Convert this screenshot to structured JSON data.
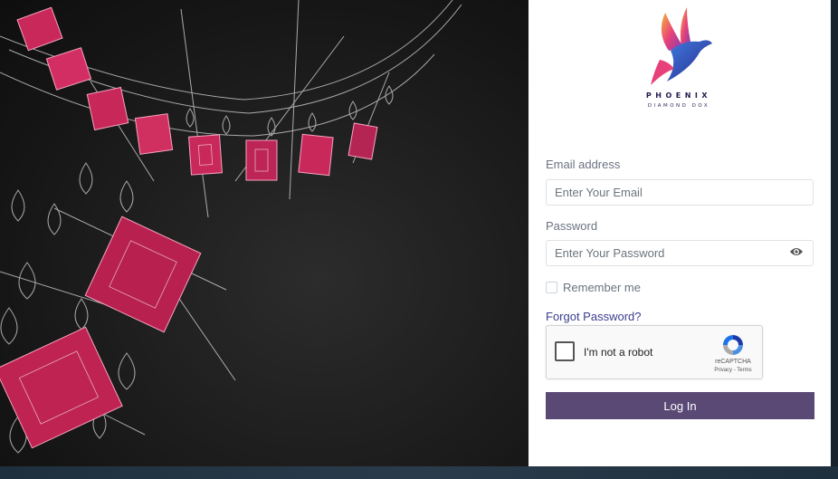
{
  "brand": {
    "name": "PHOENIX",
    "tagline": "DIAMOND DOX"
  },
  "form": {
    "email_label": "Email address",
    "email_placeholder": "Enter Your Email",
    "password_label": "Password",
    "password_placeholder": "Enter Your Password",
    "remember_label": "Remember me",
    "forgot_label": "Forgot Password?",
    "login_label": "Log In"
  },
  "captcha": {
    "label": "I'm not a robot",
    "brand": "reCAPTCHA",
    "links": "Privacy - Terms"
  },
  "colors": {
    "primary_button": "#5a4875",
    "link": "#3b3d8f",
    "gem": "#e0336b",
    "background": "#161616"
  },
  "icons": [
    "phoenix-logo",
    "eye-icon",
    "recaptcha-icon"
  ]
}
